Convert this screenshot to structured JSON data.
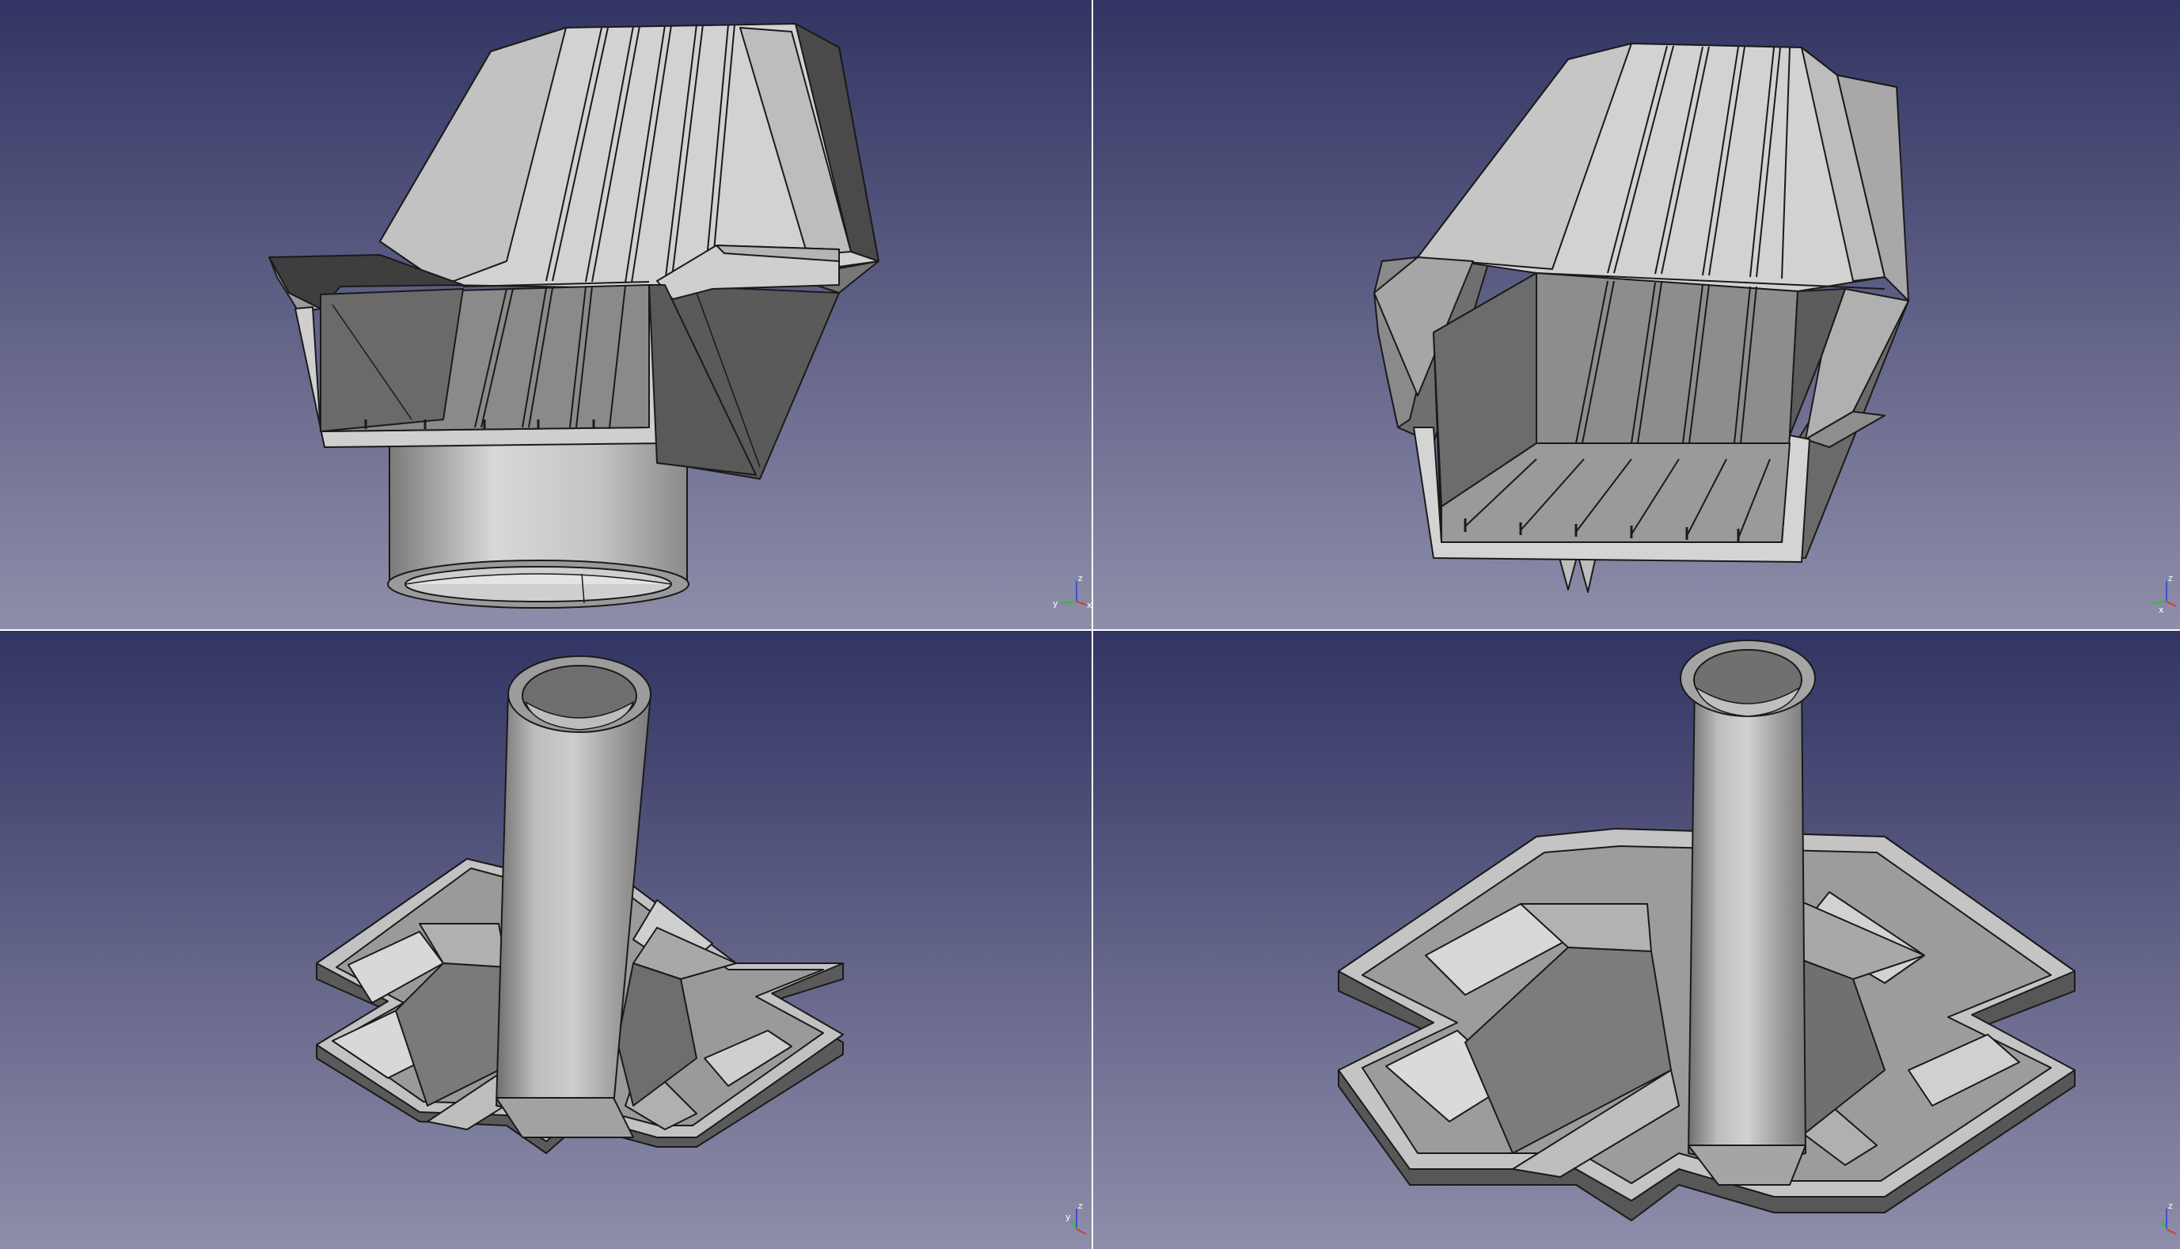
{
  "app": {
    "layout": "quad-view",
    "background_top": "#323463",
    "background_bottom": "#8c8ca8"
  },
  "viewports": [
    {
      "id": "top-left",
      "model": "seat-bracket-with-collar",
      "view": "front-isometric"
    },
    {
      "id": "top-right",
      "model": "seat-bracket-with-clip",
      "view": "front-isometric"
    },
    {
      "id": "bottom-left",
      "model": "tube-on-cross-base",
      "view": "isometric"
    },
    {
      "id": "bottom-right",
      "model": "tube-on-cross-base",
      "view": "isometric-zoomed"
    }
  ],
  "axis": {
    "x_label": "x",
    "y_label": "y",
    "z_label": "z",
    "x_color": "#d23c3c",
    "y_color": "#3cb43c",
    "z_color": "#3c50d2"
  },
  "colors": {
    "body_light": "#d6d6d6",
    "body_mid": "#aaaaaa",
    "body_dark": "#6b6b6b",
    "body_darker": "#505050",
    "edge": "#1a1a1a"
  }
}
